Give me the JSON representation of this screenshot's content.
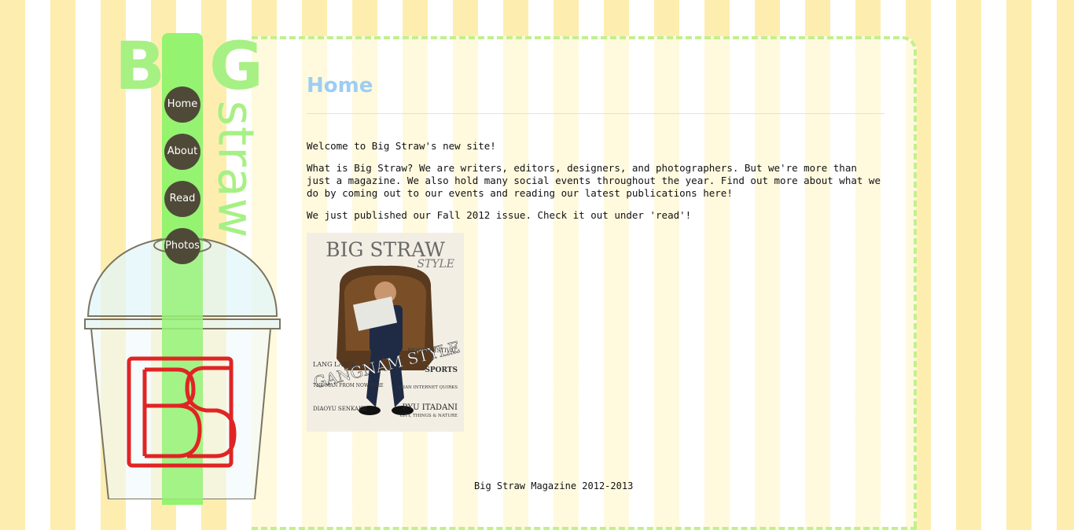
{
  "brand": {
    "logo_big_b": "B",
    "logo_big_g": "G",
    "logo_straw": "straw"
  },
  "nav": {
    "items": [
      {
        "label": "Home"
      },
      {
        "label": "About"
      },
      {
        "label": "Read"
      },
      {
        "label": "Photos"
      }
    ]
  },
  "page": {
    "title": "Home",
    "paragraphs": [
      "Welcome to Big Straw's new site!",
      "What is Big Straw? We are writers, editors, designers, and photographers. But we're more than just a magazine. We also hold many social events throughout the year. Find out more about what we do by coming out to our events and reading our latest publications here!",
      "We just published our Fall 2012 issue. Check it out under 'read'!"
    ]
  },
  "cover": {
    "masthead": "BIG STRAW",
    "subhead": "STYLE",
    "headline": "GANGNAM STYLE",
    "left_lines": [
      "LANG LANG",
      "THE MAN FROM NOWHERE",
      "DIAOYU SENKAKU"
    ],
    "right_lines": [
      "MOON FESTIVAL",
      "SPORTS",
      "ASIAN INTERNET QUIRKS",
      "RYU ITADANI",
      "CITY, THINGS & NATURE"
    ]
  },
  "cup_logo": {
    "letters": "BS"
  },
  "footer": {
    "text": "Big Straw Magazine 2012-2013"
  },
  "colors": {
    "stripe": "#fdeeb0",
    "accent_green": "#a7f084",
    "title_blue": "#9dcdf4",
    "nav_dark": "#4f4a38",
    "logo_red": "#e02424"
  }
}
